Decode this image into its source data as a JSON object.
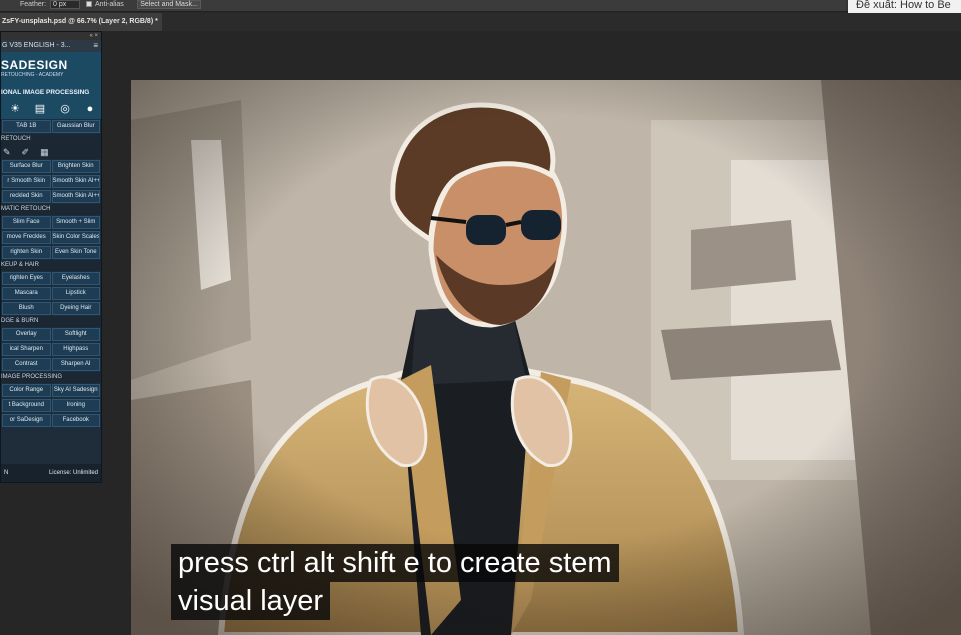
{
  "options_bar": {
    "feather_label": "Feather:",
    "feather_value": "0 px",
    "anti_alias_label": "Anti-alias",
    "select_mask_label": "Select and Mask..."
  },
  "tooltip": "Đề xuất: How to Be",
  "document_tab": {
    "title": "ZsFY-unsplash.psd @ 66.7% (Layer 2, RGB/8)",
    "modified_marker": "*",
    "close_glyph": "×"
  },
  "panel": {
    "window_controls": "«  ×",
    "title": "G V35 ENGLISH - 3...",
    "menu_glyph": "≡",
    "brand": "SADESIGN",
    "brand_sub": "RETOUCHING - ACADEMY",
    "header": "IONAL IMAGE PROCESSING",
    "top_row": [
      "TAB 1B",
      "Gaussian Blur"
    ],
    "sections": [
      {
        "title": "RETOUCH",
        "rows": [
          [
            "Surface Blur",
            "Brighten Skin"
          ],
          [
            "r Smooth Skin",
            "Smooth Skin AI++"
          ],
          [
            "reckled Skin",
            "Smooth Skin AI+++"
          ]
        ]
      },
      {
        "title": "MATIC RETOUCH",
        "rows": [
          [
            "Slim Face",
            "Smooth + Slim"
          ],
          [
            "move Freckles",
            "Skin Color Scales"
          ],
          [
            "righten Skin",
            "Even Skin Tone"
          ]
        ]
      },
      {
        "title": "KEUP & HAIR",
        "rows": [
          [
            "righten Eyes",
            "Eyelashes"
          ],
          [
            "Mascara",
            "Lipstick"
          ],
          [
            "Blush",
            "Dyeing Hair"
          ]
        ]
      },
      {
        "title": "DGE & BURN",
        "rows": [
          [
            "Overlay",
            "Softlight"
          ],
          [
            "ical Sharpen",
            "Highpass"
          ],
          [
            "Contrast",
            "Sharpen AI"
          ]
        ]
      },
      {
        "title": " IMAGE PROCESSING",
        "rows": [
          [
            "Color Range",
            "Sky AI Sadesign"
          ],
          [
            "t Background",
            "Ironing"
          ],
          [
            "or SaDesign",
            "Facebook"
          ]
        ]
      }
    ],
    "footer_left": "N",
    "footer_right": "License: Unlimited"
  },
  "subtitles": {
    "line1": "press ctrl alt shift e to create stem",
    "line2": "visual layer"
  }
}
